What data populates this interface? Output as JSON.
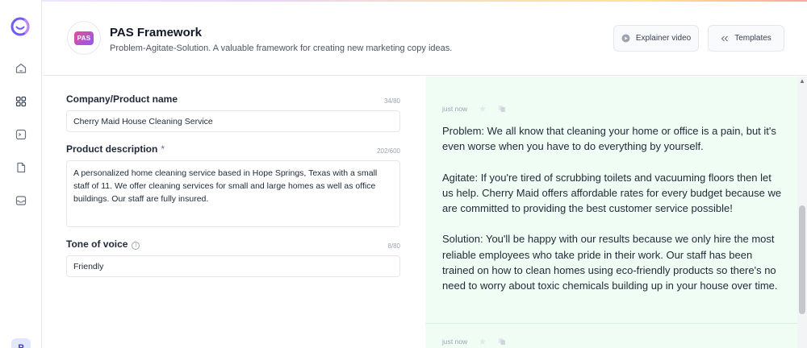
{
  "sidebar": {
    "logo": "jasper-logo-icon",
    "items": [
      {
        "icon": "home-icon"
      },
      {
        "icon": "grid-icon"
      },
      {
        "icon": "terminal-icon"
      },
      {
        "icon": "document-icon"
      },
      {
        "icon": "inbox-icon"
      }
    ],
    "avatar_initial": "P"
  },
  "header": {
    "badge_text": "PAS",
    "title": "PAS Framework",
    "subtitle": "Problem-Agitate-Solution. A valuable framework for creating new marketing copy ideas.",
    "explainer_label": "Explainer video",
    "templates_label": "Templates"
  },
  "form": {
    "company": {
      "label": "Company/Product name",
      "counter": "34/80",
      "value": "Cherry Maid House Cleaning Service"
    },
    "description": {
      "label": "Product description",
      "required_mark": "*",
      "counter": "202/600",
      "value": "A personalized home cleaning service based in Hope Springs, Texas with a small staff of 11. We offer cleaning services for small and large homes as well as office buildings. Our staff are fully insured."
    },
    "tone": {
      "label": "Tone of voice",
      "info_glyph": "i",
      "counter": "8/80",
      "value": "Friendly"
    }
  },
  "output": {
    "results": [
      {
        "time": "just now",
        "paragraphs": [
          "Problem: We all know that cleaning your home or office is a pain, but it's even worse when you have to do everything by yourself.",
          "Agitate: If you're tired of scrubbing toilets and vacuuming floors then let us help. Cherry Maid offers affordable rates for every budget because we are committed to providing the best customer service possible!",
          "Solution: You'll be happy with our results because we only hire the most reliable employees who take pride in their work. Our staff has been trained on how to clean homes using eco-friendly products so there's no need to worry about toxic chemicals building up in your house over time."
        ]
      },
      {
        "time": "just now"
      }
    ]
  },
  "colors": {
    "accent_pink": "#ec4899",
    "accent_purple": "#8b5cf6",
    "output_bg": "#f0fdf4"
  }
}
